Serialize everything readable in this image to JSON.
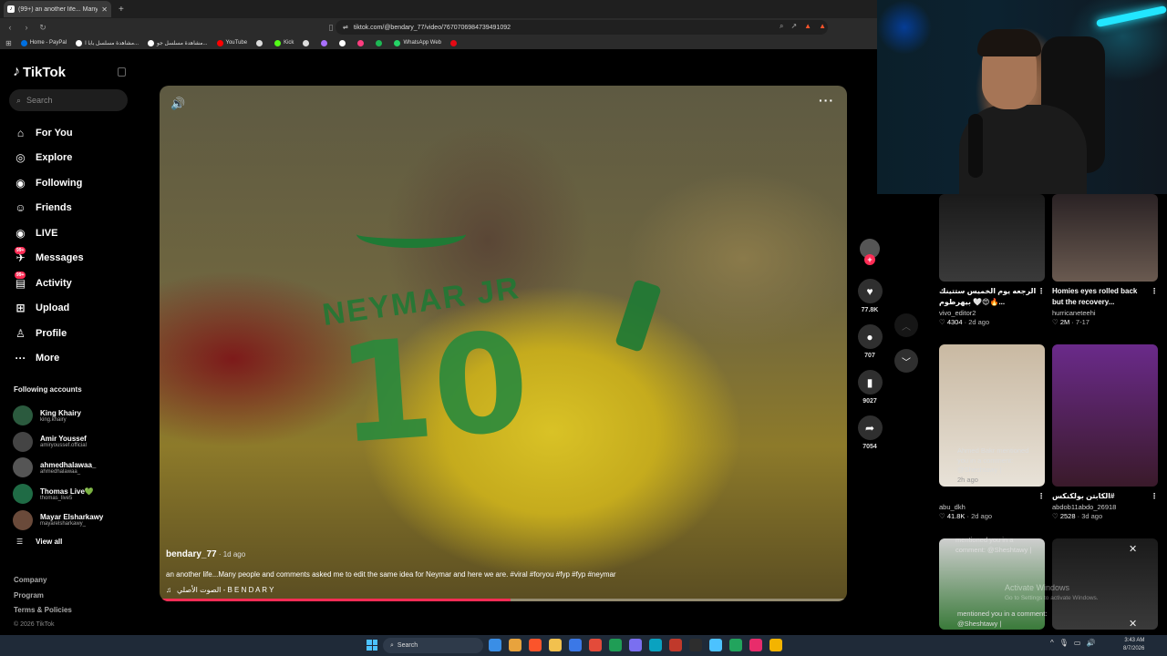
{
  "browser": {
    "tab_title": "(99+) an another life... Many peo",
    "tab_close": "✕",
    "new_tab": "+",
    "url": "tiktok.com/@bendary_77/video/7670706984739491092",
    "bookmarks": [
      {
        "label": "Home - PayPal",
        "color": "#0070e0"
      },
      {
        "label": "مشاهدة مسلسل بابا ا...",
        "color": "#ffffff"
      },
      {
        "label": "مشاهدة مسلسل جو...",
        "color": "#ffffff"
      },
      {
        "label": "YouTube",
        "color": "#ff0000"
      },
      {
        "label": "",
        "color": "#dddddd"
      },
      {
        "label": "Kick",
        "color": "#53fc18"
      },
      {
        "label": "",
        "color": "#dddddd"
      },
      {
        "label": "",
        "color": "#a970ff"
      },
      {
        "label": "",
        "color": "#ffffff"
      },
      {
        "label": "",
        "color": "#ff3d7f"
      },
      {
        "label": "",
        "color": "#1db954"
      },
      {
        "label": "WhatsApp Web",
        "color": "#25d366"
      },
      {
        "label": "",
        "color": "#e50914"
      }
    ]
  },
  "sidebar": {
    "logo": "TikTok",
    "search_placeholder": "Search",
    "nav": [
      {
        "label": "For You",
        "icon": "home-icon",
        "glyph": "⌂",
        "badge": ""
      },
      {
        "label": "Explore",
        "icon": "compass-icon",
        "glyph": "◎",
        "badge": ""
      },
      {
        "label": "Following",
        "icon": "following-icon",
        "glyph": "◉",
        "badge": ""
      },
      {
        "label": "Friends",
        "icon": "friends-icon",
        "glyph": "☺",
        "badge": ""
      },
      {
        "label": "LIVE",
        "icon": "live-icon",
        "glyph": "◉",
        "badge": ""
      },
      {
        "label": "Messages",
        "icon": "messages-icon",
        "glyph": "✈",
        "badge": "99+"
      },
      {
        "label": "Activity",
        "icon": "activity-icon",
        "glyph": "▤",
        "badge": "99+"
      },
      {
        "label": "Upload",
        "icon": "upload-icon",
        "glyph": "⊞",
        "badge": ""
      },
      {
        "label": "Profile",
        "icon": "profile-icon",
        "glyph": "♙",
        "badge": ""
      },
      {
        "label": "More",
        "icon": "more-icon",
        "glyph": "···",
        "badge": ""
      }
    ],
    "following_header": "Following accounts",
    "following": [
      {
        "name": "King Khairy",
        "user": "king.khairy",
        "color": "#2b5a3e"
      },
      {
        "name": "Amir Youssef",
        "user": "amiryoussef.official",
        "color": "#444444"
      },
      {
        "name": "ahmedhalawaa_",
        "user": "ahmedhalawaa_",
        "color": "#555555"
      },
      {
        "name": "Thomas Live💚",
        "user": "thomas_live5",
        "color": "#1f6b45"
      },
      {
        "name": "Mayar Elsharkawy",
        "user": "mayarelsharkawy_",
        "color": "#6a4a3a"
      }
    ],
    "view_all": "View all",
    "footer": [
      "Company",
      "Program",
      "Terms & Policies"
    ],
    "copyright": "© 2026 TikTok"
  },
  "video": {
    "jersey_text": "NEYMAR JR",
    "jersey_number": "10",
    "author": "bendary_77",
    "ago": " · 1d ago",
    "caption": "an another life...Many people and comments asked me to edit the same idea for Neymar and here we are. #viral #foryou #fyp #fyp #neymar",
    "sound": "الصوت الأصلي - B E N D A R Y",
    "progress": 0.51
  },
  "actions": {
    "likes": "77.8K",
    "comments": "707",
    "saves": "9027",
    "shares": "7054"
  },
  "grid": [
    {
      "desc": "الرجعه يوم الخميس ستتينك 🔥😍🤍 بيهرطوم...",
      "user": "vivo_editor2",
      "likes": "4304",
      "ago": "2d ago",
      "bg": "linear-gradient(180deg,#1a1a1a,#3a3a3a)"
    },
    {
      "desc": "Homies eyes rolled back but the recovery...",
      "user": "hurricaneteehi",
      "likes": "2M",
      "ago": "7-17",
      "bg": "linear-gradient(180deg,#2a2224,#6a5a50)"
    },
    {
      "desc": "",
      "user": "abu_dkh",
      "likes": "41.8K",
      "ago": "2d ago",
      "bg": "linear-gradient(180deg,#c9b9a2,#e8e2d8)"
    },
    {
      "desc": "الكابتن بولكنكس#",
      "user": "abdob11abdo_26918",
      "likes": "2528",
      "ago": "3d ago",
      "bg": "linear-gradient(180deg,#6a2a8a,#3a1a2a)"
    },
    {
      "desc": "",
      "user": "",
      "likes": "",
      "ago": "",
      "bg": "linear-gradient(180deg,#cfcfcf,#3a7a3a)"
    },
    {
      "desc": "",
      "user": "",
      "likes": "",
      "ago": "",
      "bg": "linear-gradient(180deg,#1a1a1a,#3a3a3a)"
    }
  ],
  "notifs": {
    "n1": "Ahmed Bakr mentioned you in a comment: @Sheshtawy |",
    "n2": "mentioned you in a comment: @Sheshtawy |",
    "n3": "mentioned you in a comment: @Sheshtawy |",
    "ago": "2h ago"
  },
  "windows": {
    "watermark": "Activate Windows",
    "watermark_sub": "Go to Settings to activate Windows.",
    "search": "Search",
    "time": "3:43 AM",
    "date": "8/7/2026"
  }
}
